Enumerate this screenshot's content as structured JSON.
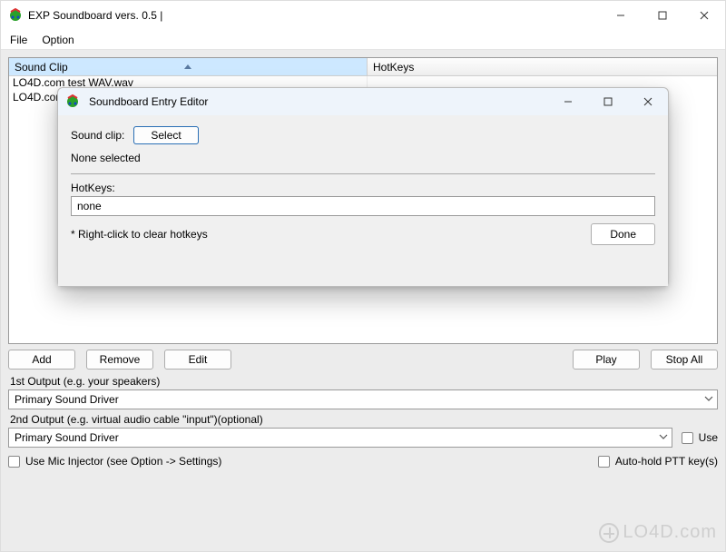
{
  "window": {
    "title": "EXP Soundboard vers. 0.5 |"
  },
  "menu": {
    "file": "File",
    "option": "Option"
  },
  "table": {
    "cols": {
      "sound": "Sound Clip",
      "hotkeys": "HotKeys"
    },
    "rows": [
      {
        "clip": "LO4D.com test WAV.wav",
        "hk": ""
      },
      {
        "clip": "LO4D.com test WAV.wav",
        "hk": ""
      }
    ]
  },
  "buttons": {
    "add": "Add",
    "remove": "Remove",
    "edit": "Edit",
    "play": "Play",
    "stop": "Stop All"
  },
  "output1": {
    "label": "1st Output (e.g. your speakers)",
    "value": "Primary Sound Driver"
  },
  "output2": {
    "label": "2nd Output (e.g. virtual audio cable \"input\")(optional)",
    "value": "Primary Sound Driver",
    "use": "Use"
  },
  "mic": {
    "label": "Use Mic Injector (see Option -> Settings)",
    "ptt": "Auto-hold PTT key(s)"
  },
  "dialog": {
    "title": "Soundboard Entry Editor",
    "soundclip_label": "Sound clip:",
    "select": "Select",
    "none_selected": "None selected",
    "hotkeys_label": "HotKeys:",
    "hotkeys_value": "none",
    "hint": "* Right-click to clear hotkeys",
    "done": "Done"
  },
  "watermark": "LO4D.com"
}
